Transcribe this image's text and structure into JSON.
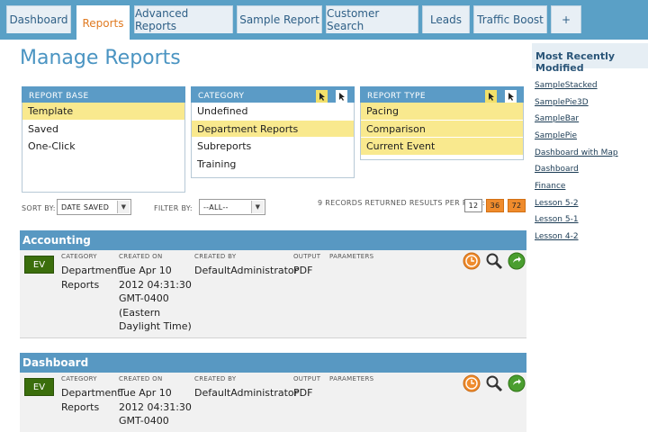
{
  "tabs": [
    "Dashboard",
    "Reports",
    "Advanced Reports",
    "Sample Report",
    "Customer Search",
    "Leads",
    "Traffic Boost",
    "+"
  ],
  "page_title": "Manage Reports",
  "filters": {
    "report_base": {
      "title": "REPORT BASE",
      "items": [
        "Template",
        "Saved",
        "One-Click"
      ]
    },
    "category": {
      "title": "CATEGORY",
      "items": [
        "Undefined",
        "Department Reports",
        "Subreports",
        "Training"
      ]
    },
    "report_type": {
      "title": "REPORT TYPE",
      "items": [
        "Pacing",
        "Comparison",
        "Current Event"
      ]
    }
  },
  "sort": {
    "sort_label": "SORT BY:",
    "sort_value": "DATE SAVED",
    "filter_label": "FILTER BY:",
    "filter_value": "--ALL--",
    "records_text": "9 RECORDS RETURNED RESULTS PER PAGE:",
    "per_page": [
      "12",
      "36",
      "72"
    ]
  },
  "groups": [
    {
      "name": "Accounting",
      "report": {
        "badge": "EV",
        "category_label": "CATEGORY",
        "category": "Department Reports",
        "created_on_label": "CREATED ON",
        "created_on": "Tue Apr 10 2012 04:31:30 GMT-0400 (Eastern Daylight Time)",
        "created_by_label": "CREATED BY",
        "created_by": "DefaultAdministrator",
        "output_label": "OUTPUT",
        "output": "PDF",
        "parameters_label": "PARAMETERS"
      }
    },
    {
      "name": "Dashboard",
      "report": {
        "badge": "EV",
        "category_label": "CATEGORY",
        "category": "Department Reports",
        "created_on_label": "CREATED ON",
        "created_on": "Tue Apr 10 2012 04:31:30 GMT-0400",
        "created_by_label": "CREATED BY",
        "created_by": "DefaultAdministrator",
        "output_label": "OUTPUT",
        "output": "PDF",
        "parameters_label": "PARAMETERS"
      }
    }
  ],
  "sidebar": {
    "title": "Most Recently Modified",
    "links": [
      "SampleStacked",
      "SamplePie3D",
      "SampleBar",
      "SamplePie",
      "Dashboard with Map",
      "Dashboard",
      "Finance",
      "Lesson 5-2",
      "Lesson 5-1",
      "Lesson 4-2"
    ]
  },
  "colors": {
    "header": "#5898c2",
    "selected": "#f9e98e",
    "badge": "#3b6e0c",
    "accent": "#ef8b2c"
  },
  "icons": [
    "schedule-icon",
    "search-icon",
    "run-icon",
    "select-all-icon",
    "cursor-icon"
  ]
}
